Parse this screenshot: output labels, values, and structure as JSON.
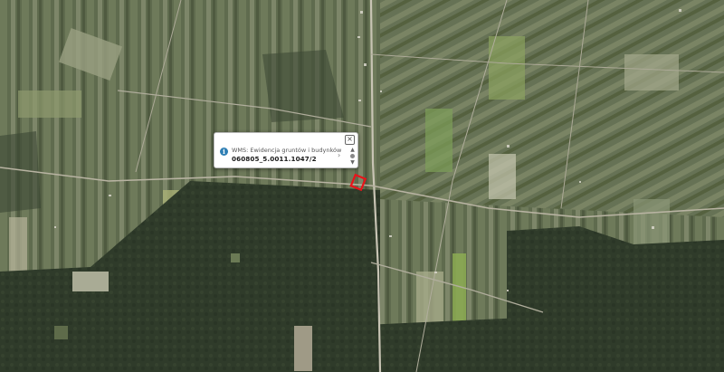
{
  "map": {
    "type": "satellite-imagery",
    "description_tags": [
      "farmland",
      "forest",
      "road",
      "parcel-outline"
    ],
    "highlight_color": "#e8141a"
  },
  "popup": {
    "info_icon": "info-icon",
    "close_icon": "close-icon",
    "close_label": "×",
    "layer_title": "WMS: Ewidencja gruntów i budynków",
    "parcel_id": "060805_5.0011.1047/2",
    "next_label": "›",
    "up_label": "▲",
    "down_label": "▼"
  }
}
